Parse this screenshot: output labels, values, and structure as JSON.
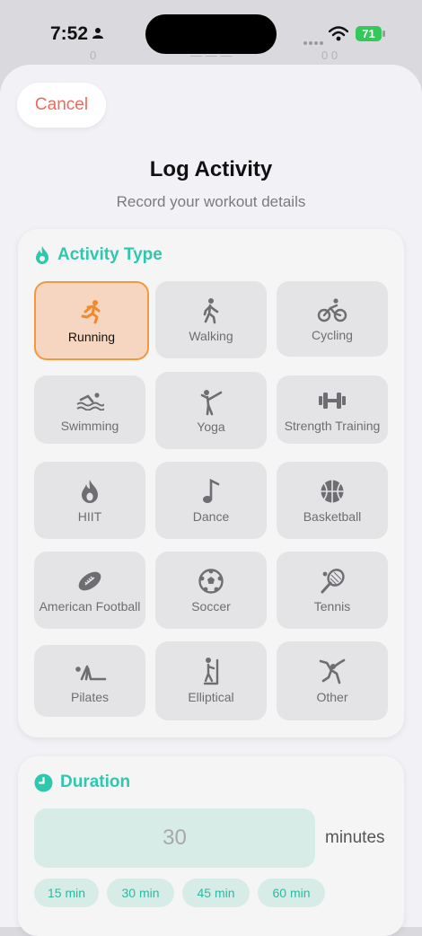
{
  "status_bar": {
    "time": "7:52",
    "battery": "71"
  },
  "sheet": {
    "cancel_label": "Cancel",
    "title": "Log Activity",
    "subtitle": "Record your workout details"
  },
  "activity_section": {
    "title": "Activity Type",
    "selected": "Running",
    "items": [
      {
        "label": "Running",
        "icon": "running-icon"
      },
      {
        "label": "Walking",
        "icon": "walking-icon"
      },
      {
        "label": "Cycling",
        "icon": "cycling-icon"
      },
      {
        "label": "Swimming",
        "icon": "swimming-icon"
      },
      {
        "label": "Yoga",
        "icon": "yoga-icon"
      },
      {
        "label": "Strength Training",
        "icon": "dumbbell-icon"
      },
      {
        "label": "HIIT",
        "icon": "flame-icon"
      },
      {
        "label": "Dance",
        "icon": "music-note-icon"
      },
      {
        "label": "Basketball",
        "icon": "basketball-icon"
      },
      {
        "label": "American Football",
        "icon": "football-icon"
      },
      {
        "label": "Soccer",
        "icon": "soccer-ball-icon"
      },
      {
        "label": "Tennis",
        "icon": "tennis-racket-icon"
      },
      {
        "label": "Pilates",
        "icon": "pilates-icon"
      },
      {
        "label": "Elliptical",
        "icon": "elliptical-icon"
      },
      {
        "label": "Other",
        "icon": "climbing-icon"
      }
    ]
  },
  "duration_section": {
    "title": "Duration",
    "value_placeholder": "30",
    "unit": "minutes",
    "presets": [
      "15 min",
      "30 min",
      "45 min",
      "60 min"
    ]
  },
  "colors": {
    "accent": "#2fc7ad",
    "selected_bg": "#f6d6c0",
    "selected_border": "#f0993f",
    "cancel": "#ec6b5e",
    "running_icon": "#f08a2c"
  }
}
